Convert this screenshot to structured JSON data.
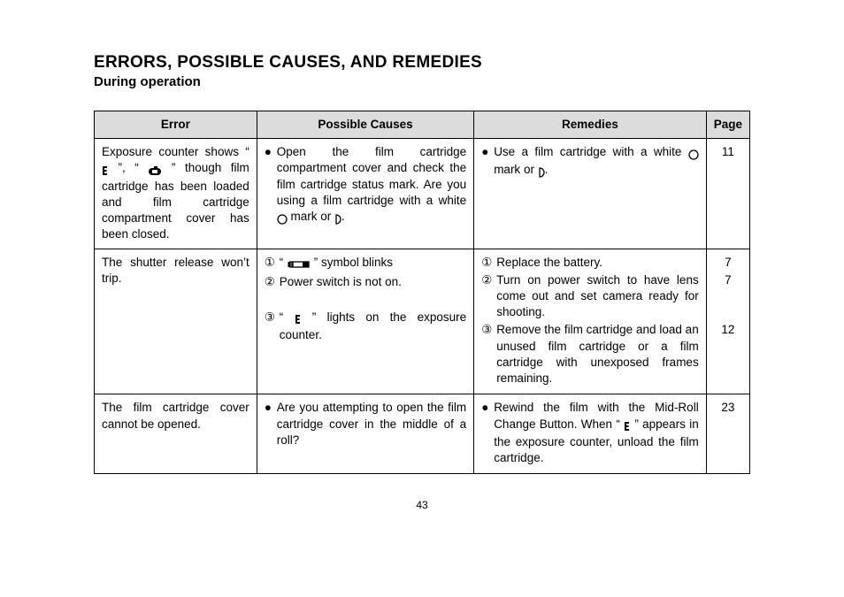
{
  "title": "ERRORS, POSSIBLE CAUSES, AND REMEDIES",
  "subtitle": "During operation",
  "headers": {
    "error": "Error",
    "causes": "Possible Causes",
    "remedies": "Remedies",
    "page": "Page"
  },
  "row1": {
    "error_a": "Exposure counter shows",
    "error_b": "“ ",
    "error_c": " ”, “ ",
    "error_d": " ” though film cartridge has been loaded and film cartridge compartment cover has been closed.",
    "cause_a": "Open the film cartridge compartment cover and check the film cartridge status mark. Are you using a film cartridge with a white ",
    "cause_b": " mark or ",
    "cause_c": ".",
    "rem_a": "Use a film cartridge with a white ",
    "rem_b": " mark or ",
    "rem_c": ".",
    "page": "11"
  },
  "row2": {
    "error": "The shutter release won’t trip.",
    "num1": "①",
    "num2": "②",
    "num3": "③",
    "c1a": "“ ",
    "c1b": " ” symbol blinks",
    "c2": "Power switch is not on.",
    "c3a": "“ ",
    "c3b": " ” lights on the exposure counter.",
    "r1": "Replace the battery.",
    "r2": "Turn on power switch to have lens come out and set camera ready for shooting.",
    "r3": "Remove the film cartridge and load an unused film cartridge or a film cartridge with unexposed frames remaining.",
    "p1": "7",
    "p2": "7",
    "p3": "12"
  },
  "row3": {
    "error": "The film cartridge cover cannot be opened.",
    "cause": "Are you attempting to open the film cartridge cover in the middle of a roll?",
    "rem_a": "Rewind the film with the Mid-Roll Change Button. When “ ",
    "rem_b": " ” appears in the exposure counter, unload the film cartridge.",
    "page": "23"
  },
  "pagenum": "43"
}
